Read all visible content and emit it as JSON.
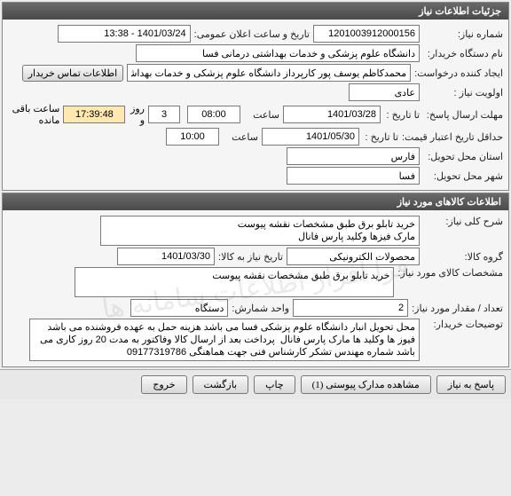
{
  "panels": {
    "need_info": "جزئیات اطلاعات نیاز",
    "items_info": "اطلاعات کالاهای مورد نیاز"
  },
  "fields": {
    "need_no_lbl": "شماره نیاز:",
    "need_no": "1201003912000156",
    "announce_lbl": "تاریخ و ساعت اعلان عمومی:",
    "announce_val": "1401/03/24 - 13:38",
    "buyer_org_lbl": "نام دستگاه خریدار:",
    "buyer_org": "دانشگاه علوم پزشکی و خدمات بهداشتی درمانی فسا",
    "creator_lbl": "ایجاد کننده درخواست:",
    "creator": "محمدکاظم یوسف پور کارپرداز دانشگاه علوم پزشکی و خدمات بهداشتی درمانی ف",
    "contact_btn": "اطلاعات تماس خریدار",
    "priority_lbl": "اولویت نیاز :",
    "priority": "عادی",
    "deadline_lbl": "مهلت ارسال پاسخ:",
    "to_date_lbl": "تا تاریخ :",
    "deadline_date": "1401/03/28",
    "time_lbl": "ساعت",
    "deadline_time": "08:00",
    "days": "3",
    "days_lbl": "روز و",
    "countdown": "17:39:48",
    "remain_lbl": "ساعت باقی مانده",
    "price_valid_lbl": "حداقل تاریخ اعتبار قیمت:",
    "price_valid_date": "1401/05/30",
    "price_valid_time": "10:00",
    "province_lbl": "استان محل تحویل:",
    "province": "فارس",
    "city_lbl": "شهر محل تحویل:",
    "city": "فسا"
  },
  "items": {
    "desc_lbl": "شرح کلی نیاز:",
    "desc": "خرید تابلو برق طبق مشخصات نقشه پیوست\nمارک فیزها وکلید پارس فانال",
    "group_lbl": "گروه کالا:",
    "group": "محصولات الکترونیکی",
    "need_date_lbl": "تاریخ نیاز به کالا:",
    "need_date": "1401/03/30",
    "item_spec_lbl": "مشخصات کالای مورد نیاز:",
    "item_spec": "خرید تابلو برق طبق مشخصات نقشه پیوست",
    "qty_lbl": "تعداد / مقدار مورد نیاز:",
    "qty": "2",
    "unit_lbl": "واحد شمارش:",
    "unit": "دستگاه",
    "buyer_note_lbl": "توضیحات خریدار:",
    "buyer_note": "محل تحویل انبار دانشگاه علوم پزشکی فسا می باشد هزینه حمل به عهده فروشنده می باشد  فیوز ها وکلید ها مارک پارس فانال  پرداخت بعد از ارسال کالا وفاکتور به مدت 20 روز کاری می باشد شماره مهندس تشکر کارشناس فنی جهت هماهنگی 09177319786"
  },
  "buttons": {
    "respond": "پاسخ به نیاز",
    "attachments": "مشاهده مدارک پیوستی (1)",
    "print": "چاپ",
    "back": "بازگشت",
    "exit": "خروج"
  },
  "watermark": "فرا افزار اطلاعات سامانه ها"
}
